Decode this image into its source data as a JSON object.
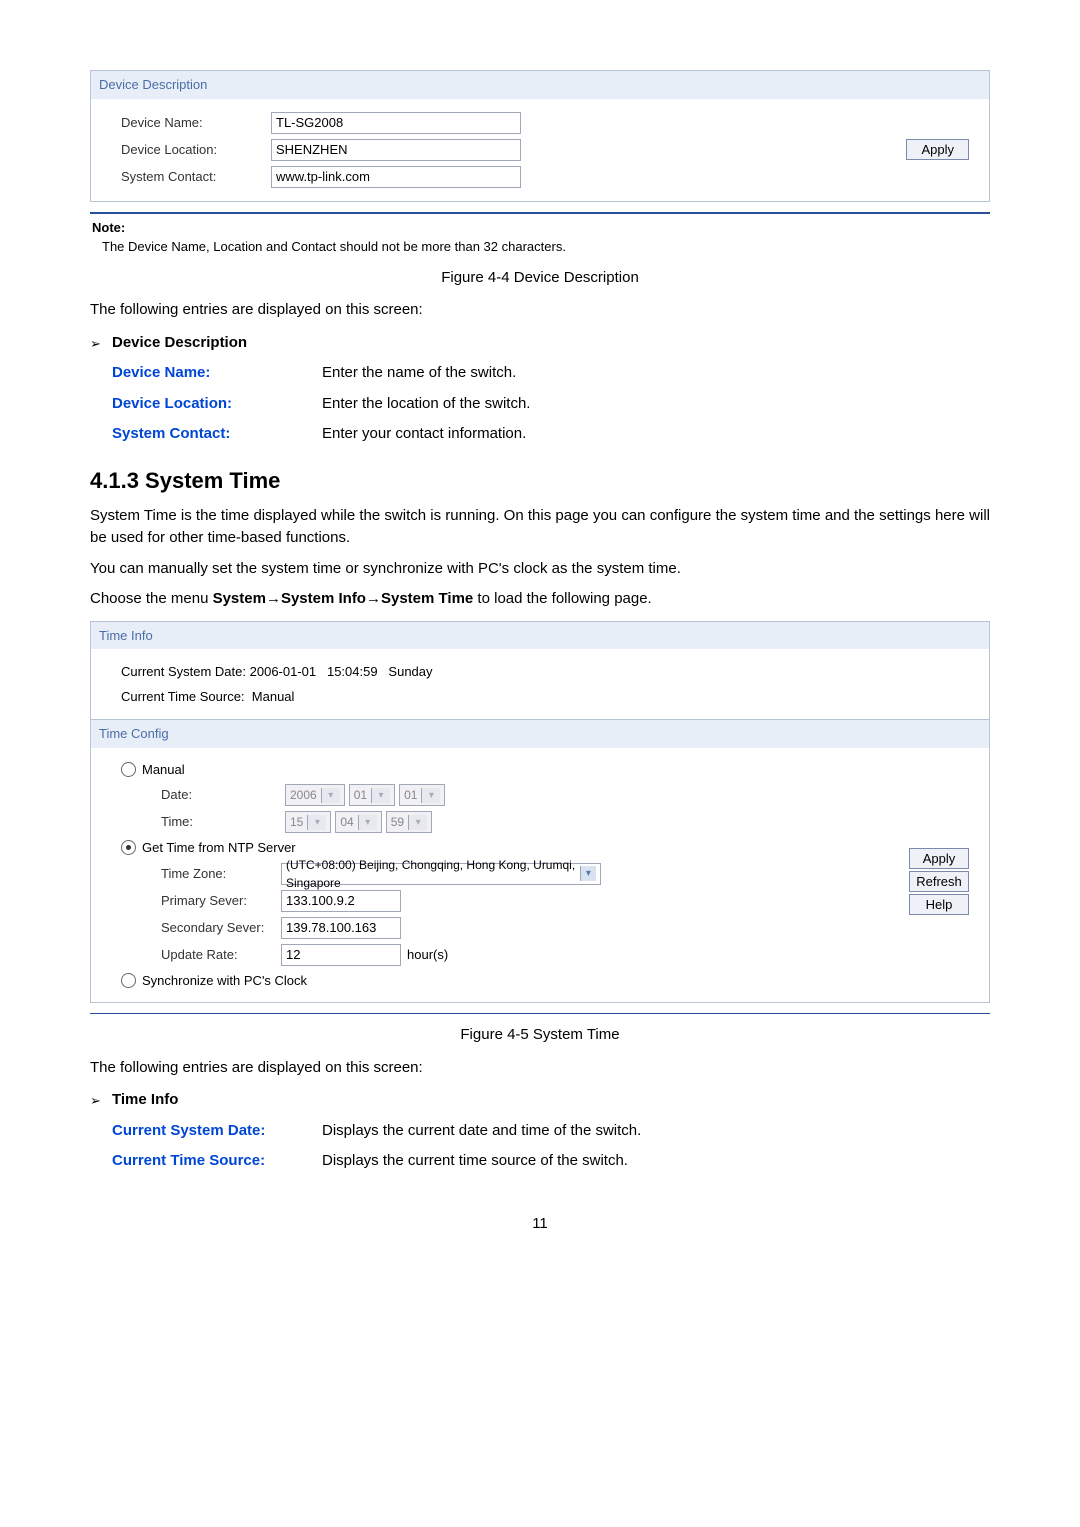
{
  "device_description_panel": {
    "title": "Device Description",
    "rows": {
      "device_name_label": "Device Name:",
      "device_name_value": "TL-SG2008",
      "device_location_label": "Device Location:",
      "device_location_value": "SHENZHEN",
      "system_contact_label": "System Contact:",
      "system_contact_value": "www.tp-link.com"
    },
    "apply_label": "Apply"
  },
  "note": {
    "label": "Note:",
    "text": "The Device Name, Location and Contact should not be more than 32 characters."
  },
  "figure4_4": "Figure 4-4 Device Description",
  "entries_intro_1": "The following entries are displayed on this screen:",
  "device_description_heading": "Device Description",
  "device_description_defs": [
    {
      "term": "Device Name:",
      "desc": "Enter the name of the switch."
    },
    {
      "term": "Device Location:",
      "desc": "Enter the location of the switch."
    },
    {
      "term": "System Contact:",
      "desc": "Enter your contact information."
    }
  ],
  "section_heading": "4.1.3 System Time",
  "system_time_para": "System Time is the time displayed while the switch is running. On this page you can configure the system time and the settings here will be used for other time-based functions.",
  "manual_para": "You can manually set the system time or synchronize with PC's clock as the system time.",
  "menu_path": {
    "prefix": "Choose the menu ",
    "b1": "System",
    "arrow1": "→",
    "b2": "System Info",
    "arrow2": "→",
    "b3": "System Time",
    "suffix": " to load the following page."
  },
  "time_info_panel": {
    "title": "Time Info",
    "current_date_label": "Current System Date:",
    "current_date_value": "2006-01-01",
    "current_time_value": "15:04:59",
    "current_day": "Sunday",
    "current_source_label": "Current Time Source:",
    "current_source_value": "Manual"
  },
  "time_config_panel": {
    "title": "Time Config",
    "manual_label": "Manual",
    "date_label": "Date:",
    "date_year": "2006",
    "date_month": "01",
    "date_day": "01",
    "time_label": "Time:",
    "time_h": "15",
    "time_m": "04",
    "time_s": "59",
    "ntp_label": "Get Time from NTP Server",
    "tz_label": "Time Zone:",
    "tz_value": "(UTC+08:00) Beijing, Chongqing, Hong Kong, Urumqi, Singapore",
    "primary_label": "Primary Sever:",
    "primary_value": "133.100.9.2",
    "secondary_label": "Secondary Sever:",
    "secondary_value": "139.78.100.163",
    "update_label": "Update Rate:",
    "update_value": "12",
    "update_unit": "hour(s)",
    "sync_label": "Synchronize with PC's Clock",
    "apply_label": "Apply",
    "refresh_label": "Refresh",
    "help_label": "Help"
  },
  "figure4_5": "Figure 4-5 System Time",
  "entries_intro_2": "The following entries are displayed on this screen:",
  "time_info_heading": "Time Info",
  "time_info_defs": [
    {
      "term": "Current System Date:",
      "desc": "Displays the current date and time of the switch."
    },
    {
      "term": "Current Time Source:",
      "desc": "Displays the current time source of the switch."
    }
  ],
  "page_number": "11"
}
